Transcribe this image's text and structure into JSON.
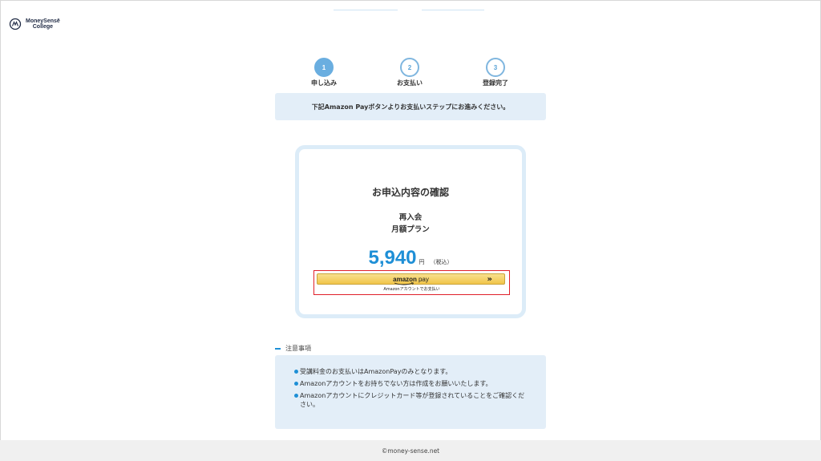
{
  "brand": {
    "name_line1": "MoneySensē",
    "name_line2": "College"
  },
  "steps": [
    {
      "number": "1",
      "label": "申し込み",
      "active": true
    },
    {
      "number": "2",
      "label": "お支払い",
      "active": false
    },
    {
      "number": "3",
      "label": "登録完了",
      "active": false
    }
  ],
  "banner": {
    "text": "下記Amazon Payボタンよりお支払いステップにお進みください。"
  },
  "card": {
    "title": "お申込内容の確認",
    "plan_line1": "再入会",
    "plan_line2": "月額プラン",
    "price": "5,940",
    "unit": "円",
    "tax_note": "（税込）",
    "pay_button": {
      "logo": "amazon",
      "logo_suffix": "pay",
      "chevron": "»",
      "caption": "Amazonアカウントでお支払い"
    }
  },
  "notes": {
    "heading": "注意事項",
    "items": [
      "受講料金のお支払いはAmazonPayのみとなります。",
      "Amazonアカウントをお持ちでない方は作成をお願いいたします。",
      "Amazonアカウントにクレジットカード等が登録されていることをご確認ください。"
    ]
  },
  "footer": {
    "copyright": "©money-sense.net"
  },
  "colors": {
    "accent": "#1e8fd6",
    "step_active": "#6aaee0",
    "panel": "#e3eef8",
    "card_border": "#dcecf8",
    "highlight": "#e0202a",
    "amazon_button": "#f1c54a"
  }
}
